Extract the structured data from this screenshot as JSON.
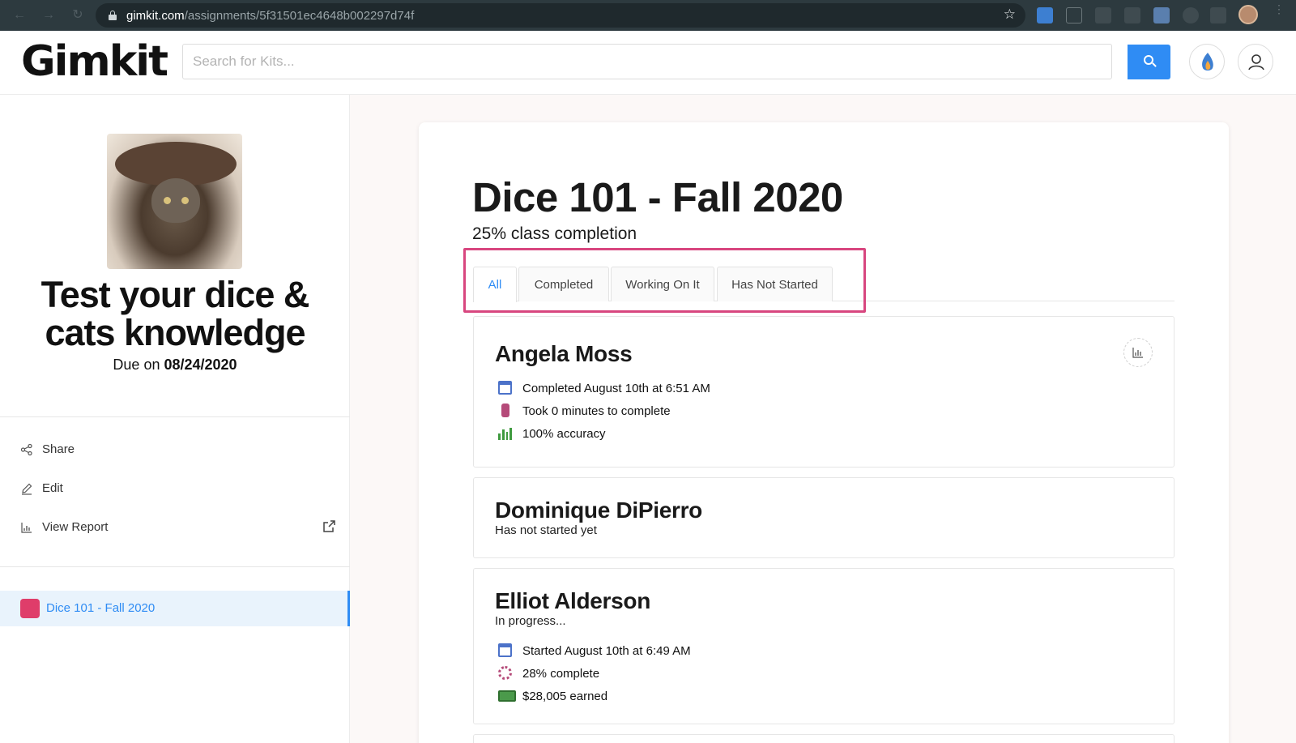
{
  "browser": {
    "url_host": "gimkit.com",
    "url_path": "/assignments/5f31501ec4648b002297d74f"
  },
  "header": {
    "logo": "Gimkit",
    "search_placeholder": "Search for Kits..."
  },
  "sidebar": {
    "kit_title": "Test your dice & cats knowledge",
    "due_label": "Due on",
    "due_date": "08/24/2020",
    "links": [
      {
        "label": "Share",
        "icon": "share-icon"
      },
      {
        "label": "Edit",
        "icon": "pencil-icon"
      },
      {
        "label": "View Report",
        "icon": "chart-icon"
      }
    ],
    "class_item": {
      "label": "Dice 101 - Fall 2020",
      "color": "#df3d6a"
    }
  },
  "main": {
    "class_title": "Dice 101 - Fall 2020",
    "completion": "25% class completion",
    "tabs": [
      {
        "label": "All",
        "active": true
      },
      {
        "label": "Completed",
        "active": false
      },
      {
        "label": "Working On It",
        "active": false
      },
      {
        "label": "Has Not Started",
        "active": false
      }
    ],
    "students": [
      {
        "name": "Angela Moss",
        "rows": [
          {
            "icon": "calendar-icon",
            "text": "Completed August 10th at 6:51 AM"
          },
          {
            "icon": "stopwatch-icon",
            "text": "Took 0 minutes to complete"
          },
          {
            "icon": "bar-chart-icon",
            "text": "100% accuracy"
          }
        ]
      },
      {
        "name": "Dominique DiPierro",
        "status": "Has not started yet"
      },
      {
        "name": "Elliot Alderson",
        "status": "In progress...",
        "rows": [
          {
            "icon": "calendar-icon",
            "text": "Started August 10th at 6:49 AM"
          },
          {
            "icon": "progress-spinner-icon",
            "text": "28% complete"
          },
          {
            "icon": "cash-icon",
            "text": "$28,005 earned"
          }
        ]
      }
    ]
  },
  "colors": {
    "accent": "#2f8cf4",
    "highlight": "#d8467f",
    "class_color": "#df3d6a"
  }
}
